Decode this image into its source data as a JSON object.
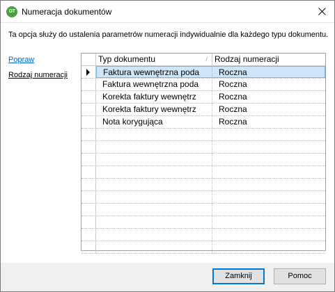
{
  "window": {
    "title": "Numeracja dokumentów",
    "icon_text": "GT",
    "icon": "app-logo-icon"
  },
  "description": "Ta opcja służy do ustalenia parametrów numeracji indywidualnie dla każdego typu dokumentu.",
  "sidebar": {
    "links": [
      {
        "label": "Popraw"
      },
      {
        "label": "Rodzaj numeracji"
      }
    ]
  },
  "grid": {
    "columns": [
      "Typ dokumentu",
      "Rodzaj numeracji"
    ],
    "sort_indicator": "/",
    "rows": [
      {
        "type": "Faktura wewnętrzna poda",
        "numbering": "Roczna"
      },
      {
        "type": "Faktura wewnętrzna poda",
        "numbering": "Roczna"
      },
      {
        "type": "Korekta faktury wewnętrz",
        "numbering": "Roczna"
      },
      {
        "type": "Korekta faktury wewnętrz",
        "numbering": "Roczna"
      },
      {
        "type": "Nota korygująca",
        "numbering": "Roczna"
      }
    ],
    "selected_row": 0
  },
  "buttons": {
    "close_label": "Zamknij",
    "help_label": "Pomoc"
  },
  "colors": {
    "link": "#0066cc",
    "selection": "#cfe5f9",
    "default_button_border": "#0078d7"
  }
}
